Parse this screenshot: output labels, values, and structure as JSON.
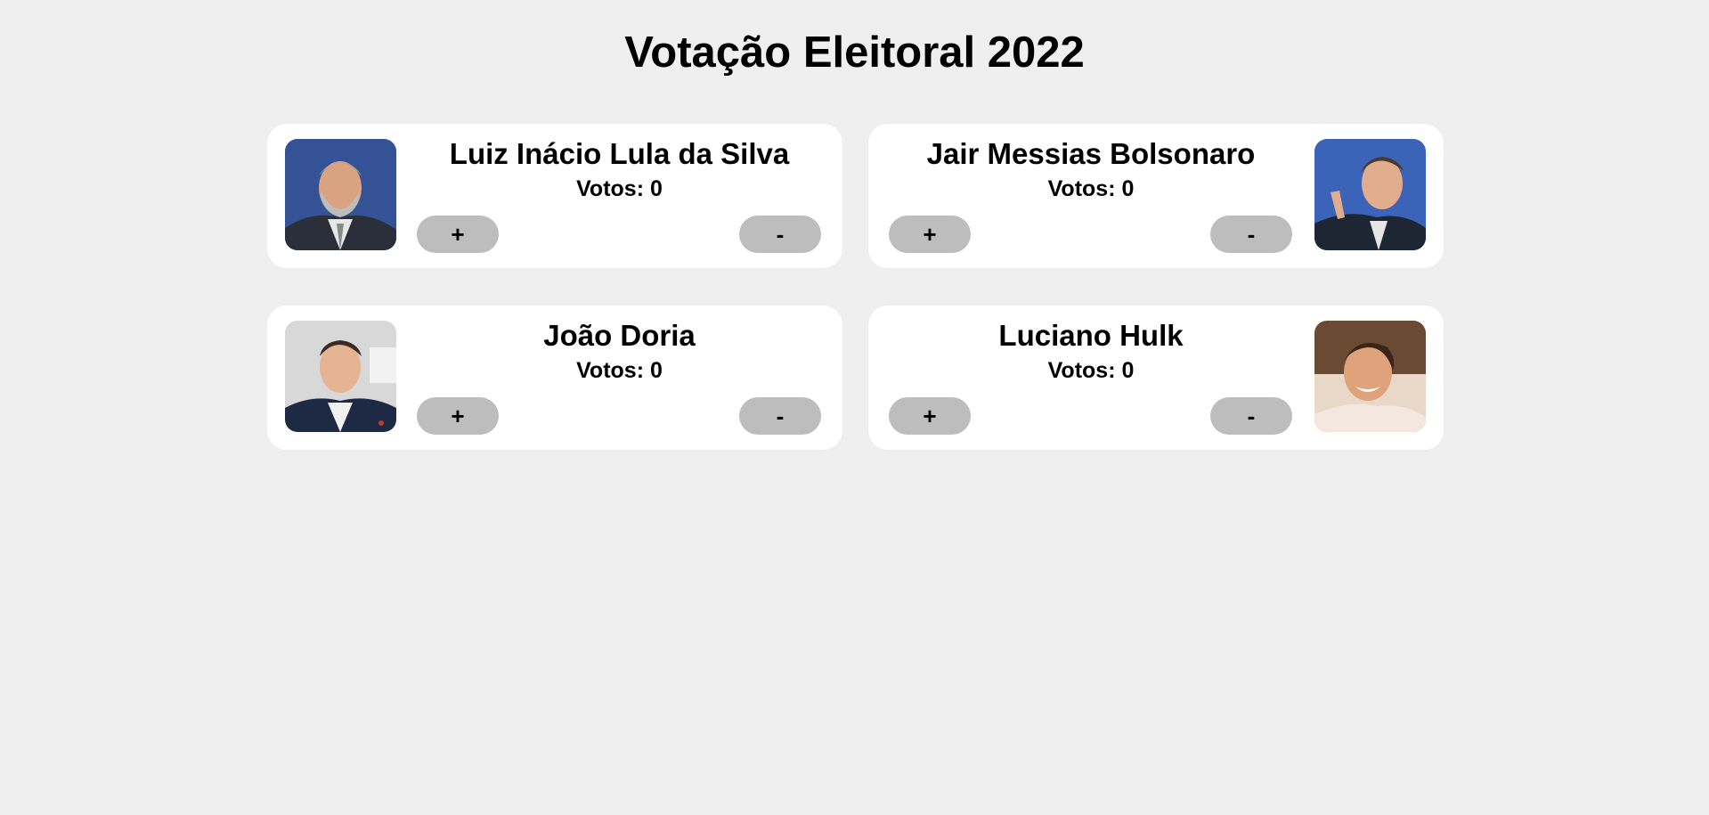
{
  "page": {
    "title": "Votação Eleitoral 2022"
  },
  "candidates": [
    {
      "name": "Luiz Inácio Lula da Silva",
      "votes_label": "Votos:",
      "votes": 0,
      "plus": "+",
      "minus": "-",
      "photo": "candidate-photo"
    },
    {
      "name": "Jair Messias Bolsonaro",
      "votes_label": "Votos:",
      "votes": 0,
      "plus": "+",
      "minus": "-",
      "photo": "candidate-photo"
    },
    {
      "name": "João Doria",
      "votes_label": "Votos:",
      "votes": 0,
      "plus": "+",
      "minus": "-",
      "photo": "candidate-photo"
    },
    {
      "name": "Luciano Hulk",
      "votes_label": "Votos:",
      "votes": 0,
      "plus": "+",
      "minus": "-",
      "photo": "candidate-photo"
    }
  ],
  "colors": {
    "background": "#efefef",
    "card": "#ffffff",
    "button": "#bdbdbd"
  }
}
